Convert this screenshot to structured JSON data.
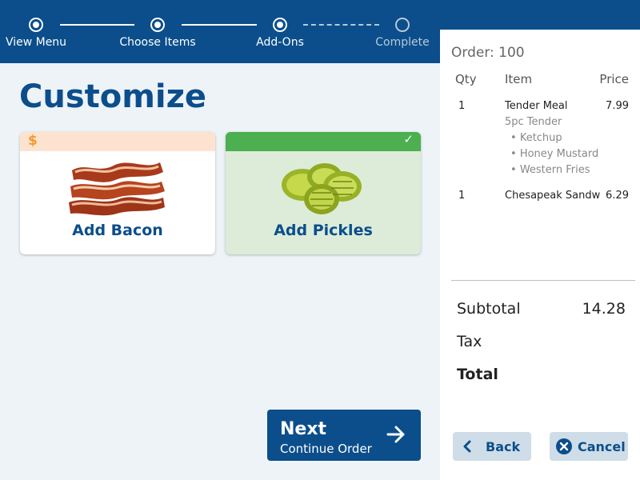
{
  "steps": [
    {
      "label": "View Menu",
      "state": "done"
    },
    {
      "label": "Choose Items",
      "state": "done"
    },
    {
      "label": "Add-Ons",
      "state": "current"
    },
    {
      "label": "Complete",
      "state": "pending"
    }
  ],
  "main": {
    "title": "Customize",
    "addons": [
      {
        "name": "Add Bacon",
        "badge": "$",
        "selected": false,
        "icon": "bacon-image"
      },
      {
        "name": "Add Pickles",
        "badge": "✓",
        "selected": true,
        "icon": "pickles-image"
      }
    ],
    "next_button": {
      "label": "Next",
      "sublabel": "Continue Order"
    }
  },
  "order": {
    "title": "Order: 100",
    "columns": {
      "qty": "Qty",
      "item": "Item",
      "price": "Price"
    },
    "items": [
      {
        "qty": "1",
        "name": "Tender Meal",
        "price": "7.99",
        "modifier": "5pc Tender",
        "sub_modifiers": [
          "Ketchup",
          "Honey Mustard",
          "Western Fries"
        ]
      },
      {
        "qty": "1",
        "name": "Chesapeak Sandw",
        "price": "6.29"
      }
    ],
    "subtotal_label": "Subtotal",
    "subtotal_value": "14.28",
    "tax_label": "Tax",
    "total_label": "Total",
    "back_label": "Back",
    "cancel_label": "Cancel"
  },
  "colors": {
    "primary": "#0b4e8b",
    "selected_green": "#4caf50",
    "price_orange": "#f39a2c"
  }
}
